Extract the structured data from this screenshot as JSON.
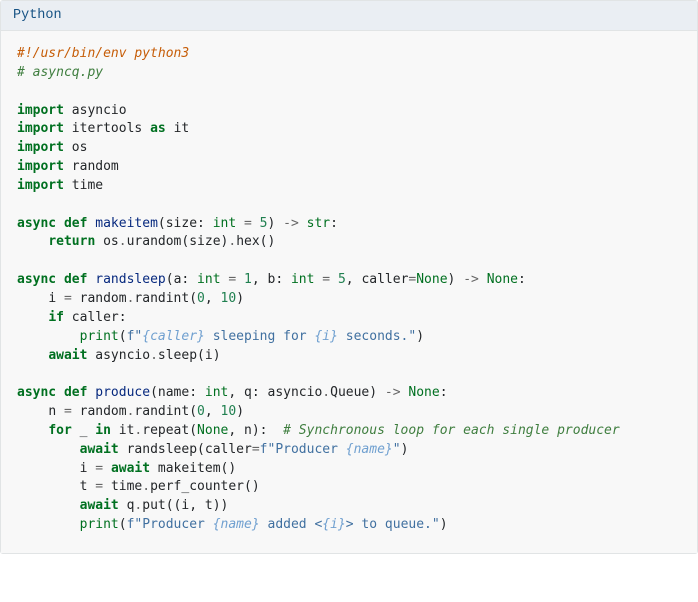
{
  "header": {
    "language": "Python"
  },
  "colors": {
    "header_bg": "#eaeef3",
    "header_text": "#175384",
    "body_bg": "#f8f8f8",
    "keyword": "#007020",
    "func": "#06287e",
    "comment": "#3f7e3f",
    "shebang": "#c65d08",
    "string": "#4070a0",
    "interp": "#70a0d0",
    "number": "#208050",
    "operator": "#666666"
  },
  "code": {
    "lines": [
      {
        "t": "shebang",
        "text": "#!/usr/bin/env python3"
      },
      {
        "t": "comment",
        "text": "# asyncq.py"
      },
      {
        "t": "blank"
      },
      {
        "t": "import",
        "mod": "asyncio"
      },
      {
        "t": "import_as",
        "mod": "itertools",
        "alias": "it"
      },
      {
        "t": "import",
        "mod": "os"
      },
      {
        "t": "import",
        "mod": "random"
      },
      {
        "t": "import",
        "mod": "time"
      },
      {
        "t": "blank"
      },
      {
        "t": "def_makeitem",
        "kw1": "async",
        "kw2": "def",
        "name": "makeitem",
        "p1": "size",
        "ann1": "int",
        "d1": "5",
        "ret": "str"
      },
      {
        "t": "return_urandom",
        "indent": 1,
        "kw": "return",
        "obj": "os",
        "f1": "urandom",
        "arg": "size",
        "f2": "hex"
      },
      {
        "t": "blank"
      },
      {
        "t": "def_randsleep",
        "kw1": "async",
        "kw2": "def",
        "name": "randsleep",
        "p1": "a",
        "ann1": "int",
        "d1": "1",
        "p2": "b",
        "ann2": "int",
        "d2": "5",
        "p3": "caller",
        "d3": "None",
        "ret": "None"
      },
      {
        "t": "assign_randint",
        "indent": 1,
        "var": "i",
        "obj": "random",
        "fn": "randint",
        "a1": "0",
        "a2": "10"
      },
      {
        "t": "if",
        "indent": 1,
        "kw": "if",
        "cond": "caller"
      },
      {
        "t": "print_f",
        "indent": 2,
        "fn": "print",
        "pre": "",
        "i1": "caller",
        "mid": " sleeping for ",
        "i2": "i",
        "post": " seconds."
      },
      {
        "t": "await_call",
        "indent": 1,
        "kw": "await",
        "obj": "asyncio",
        "fn": "sleep",
        "arg": "i"
      },
      {
        "t": "blank"
      },
      {
        "t": "def_produce",
        "kw1": "async",
        "kw2": "def",
        "name": "produce",
        "p1": "name",
        "ann1": "int",
        "p2": "q",
        "ann2obj": "asyncio",
        "ann2attr": "Queue",
        "ret": "None"
      },
      {
        "t": "assign_randint",
        "indent": 1,
        "var": "n",
        "obj": "random",
        "fn": "randint",
        "a1": "0",
        "a2": "10"
      },
      {
        "t": "for_repeat",
        "indent": 1,
        "kw": "for",
        "var": "_",
        "kin": "in",
        "obj": "it",
        "fn": "repeat",
        "a1": "None",
        "a2": "n",
        "comment": "# Synchronous loop for each single producer"
      },
      {
        "t": "await_randsleep",
        "indent": 2,
        "kw": "await",
        "fn": "randsleep",
        "kwarg": "caller",
        "spre": "Producer ",
        "ivar": "name",
        "spost": ""
      },
      {
        "t": "assign_await",
        "indent": 2,
        "var": "i",
        "kw": "await",
        "fn": "makeitem"
      },
      {
        "t": "assign_call2",
        "indent": 2,
        "var": "t",
        "obj": "time",
        "fn": "perf_counter"
      },
      {
        "t": "await_put",
        "indent": 2,
        "kw": "await",
        "obj": "q",
        "fn": "put",
        "a1": "i",
        "a2": "t"
      },
      {
        "t": "print_f2",
        "indent": 2,
        "fn": "print",
        "pre": "Producer ",
        "i1": "name",
        "mid": " added <",
        "i2": "i",
        "post": "> to queue."
      }
    ]
  }
}
